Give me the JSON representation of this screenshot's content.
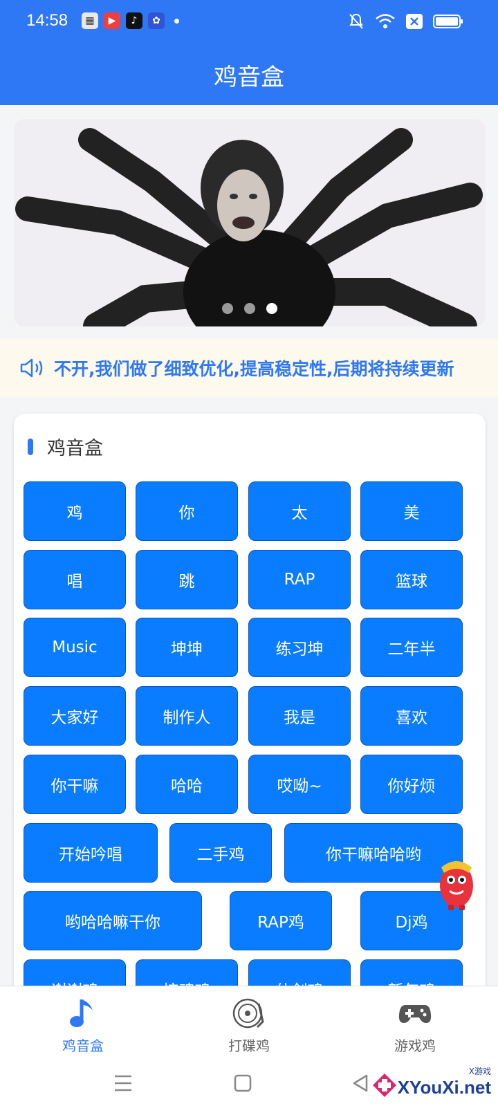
{
  "status_bar": {
    "time": "14:58"
  },
  "header": {
    "title": "鸡音盒"
  },
  "banner": {
    "slide_count": 3,
    "active_slide": 3
  },
  "notice": {
    "text": "不开,我们做了细致优化,提高稳定性,后期将持续更新"
  },
  "section": {
    "title": "鸡音盒",
    "buttons": [
      "鸡",
      "你",
      "太",
      "美",
      "唱",
      "跳",
      "RAP",
      "篮球",
      "Music",
      "坤坤",
      "练习坤",
      "二年半",
      "大家好",
      "制作人",
      "我是",
      "喜欢",
      "你干嘛",
      "哈哈",
      "哎呦~",
      "你好烦",
      "开始吟唱",
      "二手鸡",
      "你干嘛哈哈哟",
      "哟哈哈嘛干你",
      "RAP鸡",
      "Dj鸡",
      "谢谢鸡",
      "惊魂鸡",
      "仙剑鸡",
      "新年鸡"
    ]
  },
  "tabs": [
    {
      "label": "鸡音盒",
      "icon": "music-note-icon",
      "active": true
    },
    {
      "label": "打碟鸡",
      "icon": "turntable-icon",
      "active": false
    },
    {
      "label": "游戏鸡",
      "icon": "gamepad-icon",
      "active": false
    }
  ],
  "watermark": {
    "main": "XYouXi.net",
    "small": "X游戏"
  },
  "colors": {
    "primary": "#2f78f5",
    "button": "#0a7cff",
    "notice_bg": "#fdf9ec"
  }
}
